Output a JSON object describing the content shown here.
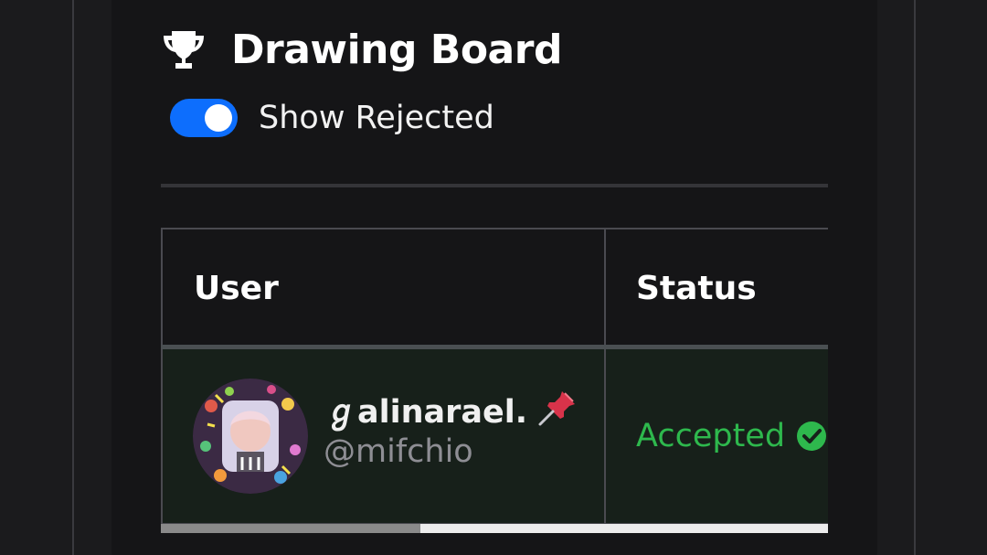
{
  "header": {
    "title": "Drawing Board",
    "icon": "trophy-icon"
  },
  "toggle": {
    "label": "Show Rejected",
    "checked": true,
    "color": "#0d6efd"
  },
  "table": {
    "columns": [
      "User",
      "Status"
    ],
    "rows": [
      {
        "display_name": "ℊalinarael.",
        "display_name_icon": "pushpin-icon",
        "handle": "@mifchio",
        "status": "Accepted",
        "status_icon": "check-circle-icon",
        "status_color": "#2eb84d"
      }
    ]
  },
  "scroll": {
    "horizontal_position": 0.39
  }
}
